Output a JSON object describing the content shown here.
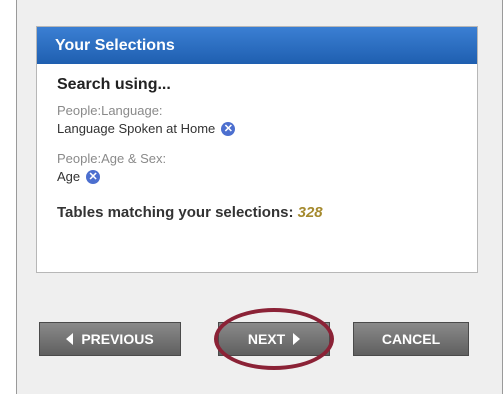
{
  "selections": {
    "header": "Your Selections",
    "search_title": "Search using...",
    "criteria": [
      {
        "category": "People:Language:",
        "value": "Language Spoken at Home"
      },
      {
        "category": "People:Age & Sex:",
        "value": "Age"
      }
    ],
    "matching_label": "Tables matching your selections:",
    "matching_count": "328"
  },
  "buttons": {
    "previous": "PREVIOUS",
    "next": "NEXT",
    "cancel": "CANCEL"
  },
  "colors": {
    "header_blue": "#2b6cc4",
    "button_gray": "#707070",
    "count_gold": "#a58a2e",
    "highlight_ring": "#8b2236"
  },
  "icons": {
    "remove": "remove-icon",
    "previous": "triangle-left-icon",
    "next": "triangle-right-icon"
  }
}
